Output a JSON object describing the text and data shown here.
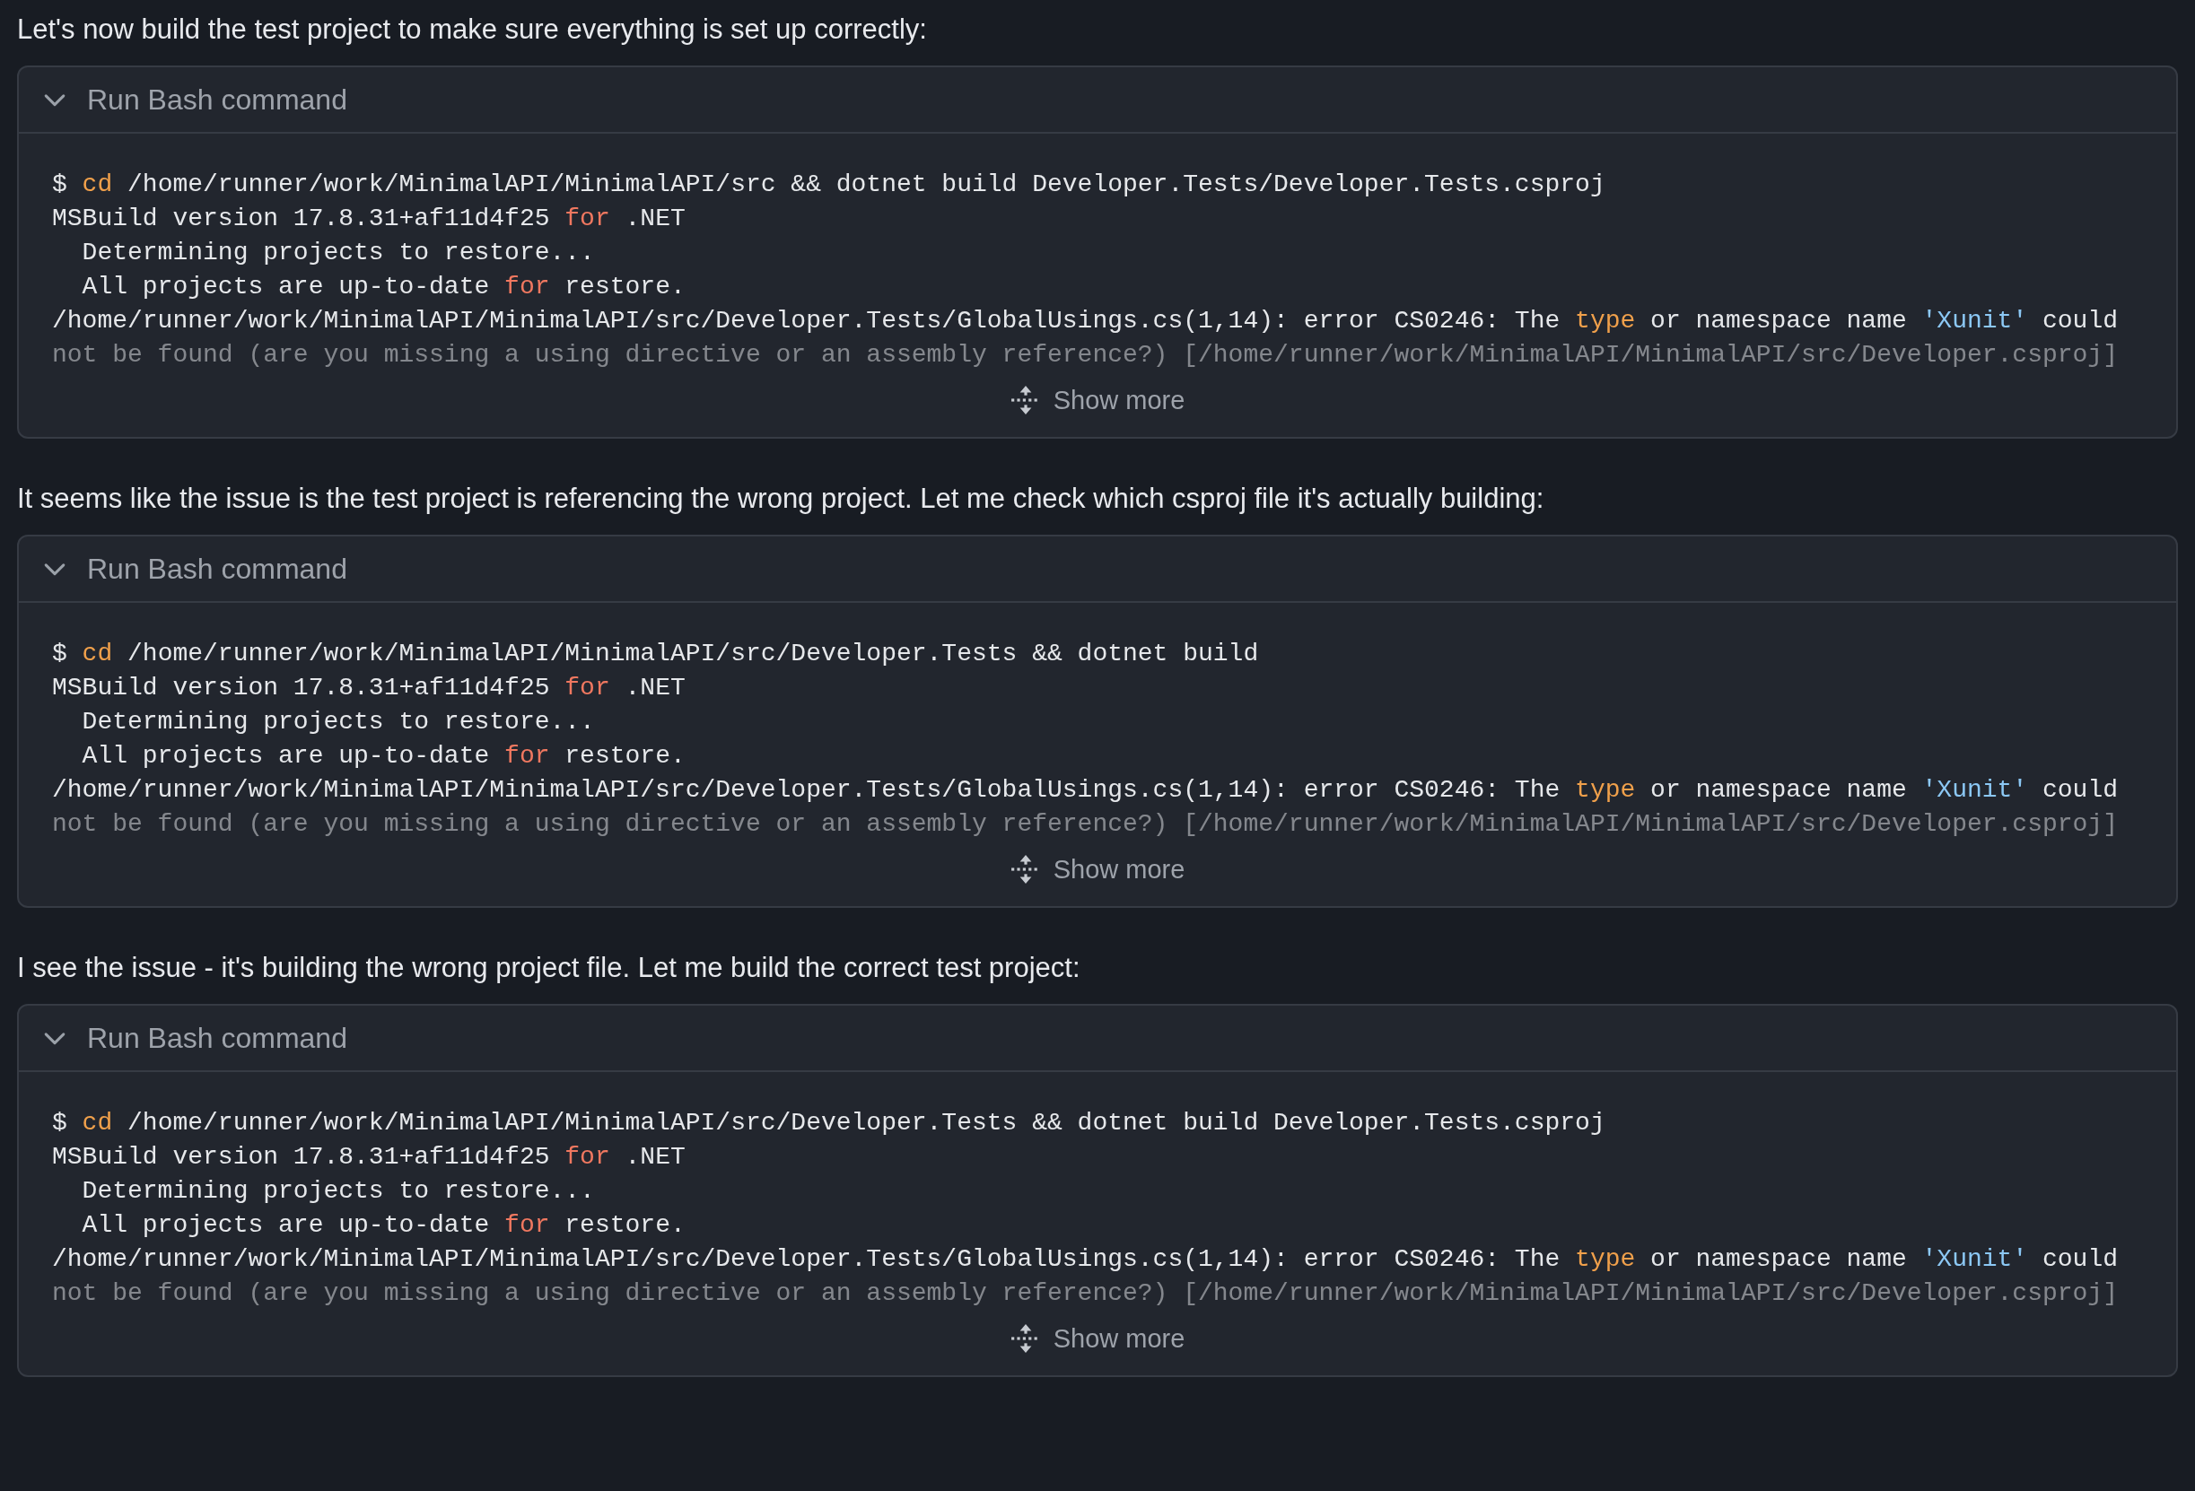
{
  "sections": [
    {
      "message": "Let's now build the test project to make sure everything is set up correctly:",
      "tool": {
        "title": "Run Bash command",
        "expanded": true,
        "lines": [
          {
            "faded": false,
            "segments": [
              {
                "kind": "plain",
                "text": "$ "
              },
              {
                "kind": "builtin",
                "text": "cd"
              },
              {
                "kind": "plain",
                "text": " /home/runner/work/MinimalAPI/MinimalAPI/src && dotnet build Developer.Tests/Developer.Tests.csproj"
              }
            ]
          },
          {
            "faded": false,
            "segments": [
              {
                "kind": "plain",
                "text": "MSBuild version 17.8.31+af11d4f25 "
              },
              {
                "kind": "keyword",
                "text": "for"
              },
              {
                "kind": "plain",
                "text": " .NET"
              }
            ]
          },
          {
            "faded": false,
            "segments": [
              {
                "kind": "plain",
                "text": "  Determining projects to restore..."
              }
            ]
          },
          {
            "faded": false,
            "segments": [
              {
                "kind": "plain",
                "text": "  All projects are up-to-date "
              },
              {
                "kind": "keyword",
                "text": "for"
              },
              {
                "kind": "plain",
                "text": " restore."
              }
            ]
          },
          {
            "faded": false,
            "segments": [
              {
                "kind": "plain",
                "text": "/home/runner/work/MinimalAPI/MinimalAPI/src/Developer.Tests/GlobalUsings.cs(1,14): error CS0246: The "
              },
              {
                "kind": "builtin",
                "text": "type"
              },
              {
                "kind": "plain",
                "text": " or namespace name "
              },
              {
                "kind": "string",
                "text": "'Xunit'"
              },
              {
                "kind": "plain",
                "text": " could"
              }
            ]
          },
          {
            "faded": true,
            "segments": [
              {
                "kind": "plain",
                "text": "not be found (are you missing a using directive or an assembly reference?) [/home/runner/work/MinimalAPI/MinimalAPI/src/Developer.csproj]"
              }
            ]
          }
        ],
        "show_more": "Show more"
      }
    },
    {
      "message": "It seems like the issue is the test project is referencing the wrong project. Let me check which csproj file it's actually building:",
      "tool": {
        "title": "Run Bash command",
        "expanded": true,
        "lines": [
          {
            "faded": false,
            "segments": [
              {
                "kind": "plain",
                "text": "$ "
              },
              {
                "kind": "builtin",
                "text": "cd"
              },
              {
                "kind": "plain",
                "text": " /home/runner/work/MinimalAPI/MinimalAPI/src/Developer.Tests && dotnet build"
              }
            ]
          },
          {
            "faded": false,
            "segments": [
              {
                "kind": "plain",
                "text": "MSBuild version 17.8.31+af11d4f25 "
              },
              {
                "kind": "keyword",
                "text": "for"
              },
              {
                "kind": "plain",
                "text": " .NET"
              }
            ]
          },
          {
            "faded": false,
            "segments": [
              {
                "kind": "plain",
                "text": "  Determining projects to restore..."
              }
            ]
          },
          {
            "faded": false,
            "segments": [
              {
                "kind": "plain",
                "text": "  All projects are up-to-date "
              },
              {
                "kind": "keyword",
                "text": "for"
              },
              {
                "kind": "plain",
                "text": " restore."
              }
            ]
          },
          {
            "faded": false,
            "segments": [
              {
                "kind": "plain",
                "text": "/home/runner/work/MinimalAPI/MinimalAPI/src/Developer.Tests/GlobalUsings.cs(1,14): error CS0246: The "
              },
              {
                "kind": "builtin",
                "text": "type"
              },
              {
                "kind": "plain",
                "text": " or namespace name "
              },
              {
                "kind": "string",
                "text": "'Xunit'"
              },
              {
                "kind": "plain",
                "text": " could"
              }
            ]
          },
          {
            "faded": true,
            "segments": [
              {
                "kind": "plain",
                "text": "not be found (are you missing a using directive or an assembly reference?) [/home/runner/work/MinimalAPI/MinimalAPI/src/Developer.csproj]"
              }
            ]
          }
        ],
        "show_more": "Show more"
      }
    },
    {
      "message": "I see the issue - it's building the wrong project file. Let me build the correct test project:",
      "tool": {
        "title": "Run Bash command",
        "expanded": true,
        "lines": [
          {
            "faded": false,
            "segments": [
              {
                "kind": "plain",
                "text": "$ "
              },
              {
                "kind": "builtin",
                "text": "cd"
              },
              {
                "kind": "plain",
                "text": " /home/runner/work/MinimalAPI/MinimalAPI/src/Developer.Tests && dotnet build Developer.Tests.csproj"
              }
            ]
          },
          {
            "faded": false,
            "segments": [
              {
                "kind": "plain",
                "text": "MSBuild version 17.8.31+af11d4f25 "
              },
              {
                "kind": "keyword",
                "text": "for"
              },
              {
                "kind": "plain",
                "text": " .NET"
              }
            ]
          },
          {
            "faded": false,
            "segments": [
              {
                "kind": "plain",
                "text": "  Determining projects to restore..."
              }
            ]
          },
          {
            "faded": false,
            "segments": [
              {
                "kind": "plain",
                "text": "  All projects are up-to-date "
              },
              {
                "kind": "keyword",
                "text": "for"
              },
              {
                "kind": "plain",
                "text": " restore."
              }
            ]
          },
          {
            "faded": false,
            "segments": [
              {
                "kind": "plain",
                "text": "/home/runner/work/MinimalAPI/MinimalAPI/src/Developer.Tests/GlobalUsings.cs(1,14): error CS0246: The "
              },
              {
                "kind": "builtin",
                "text": "type"
              },
              {
                "kind": "plain",
                "text": " or namespace name "
              },
              {
                "kind": "string",
                "text": "'Xunit'"
              },
              {
                "kind": "plain",
                "text": " could"
              }
            ]
          },
          {
            "faded": true,
            "segments": [
              {
                "kind": "plain",
                "text": "not be found (are you missing a using directive or an assembly reference?) [/home/runner/work/MinimalAPI/MinimalAPI/src/Developer.csproj]"
              }
            ]
          }
        ],
        "show_more": "Show more"
      }
    }
  ]
}
